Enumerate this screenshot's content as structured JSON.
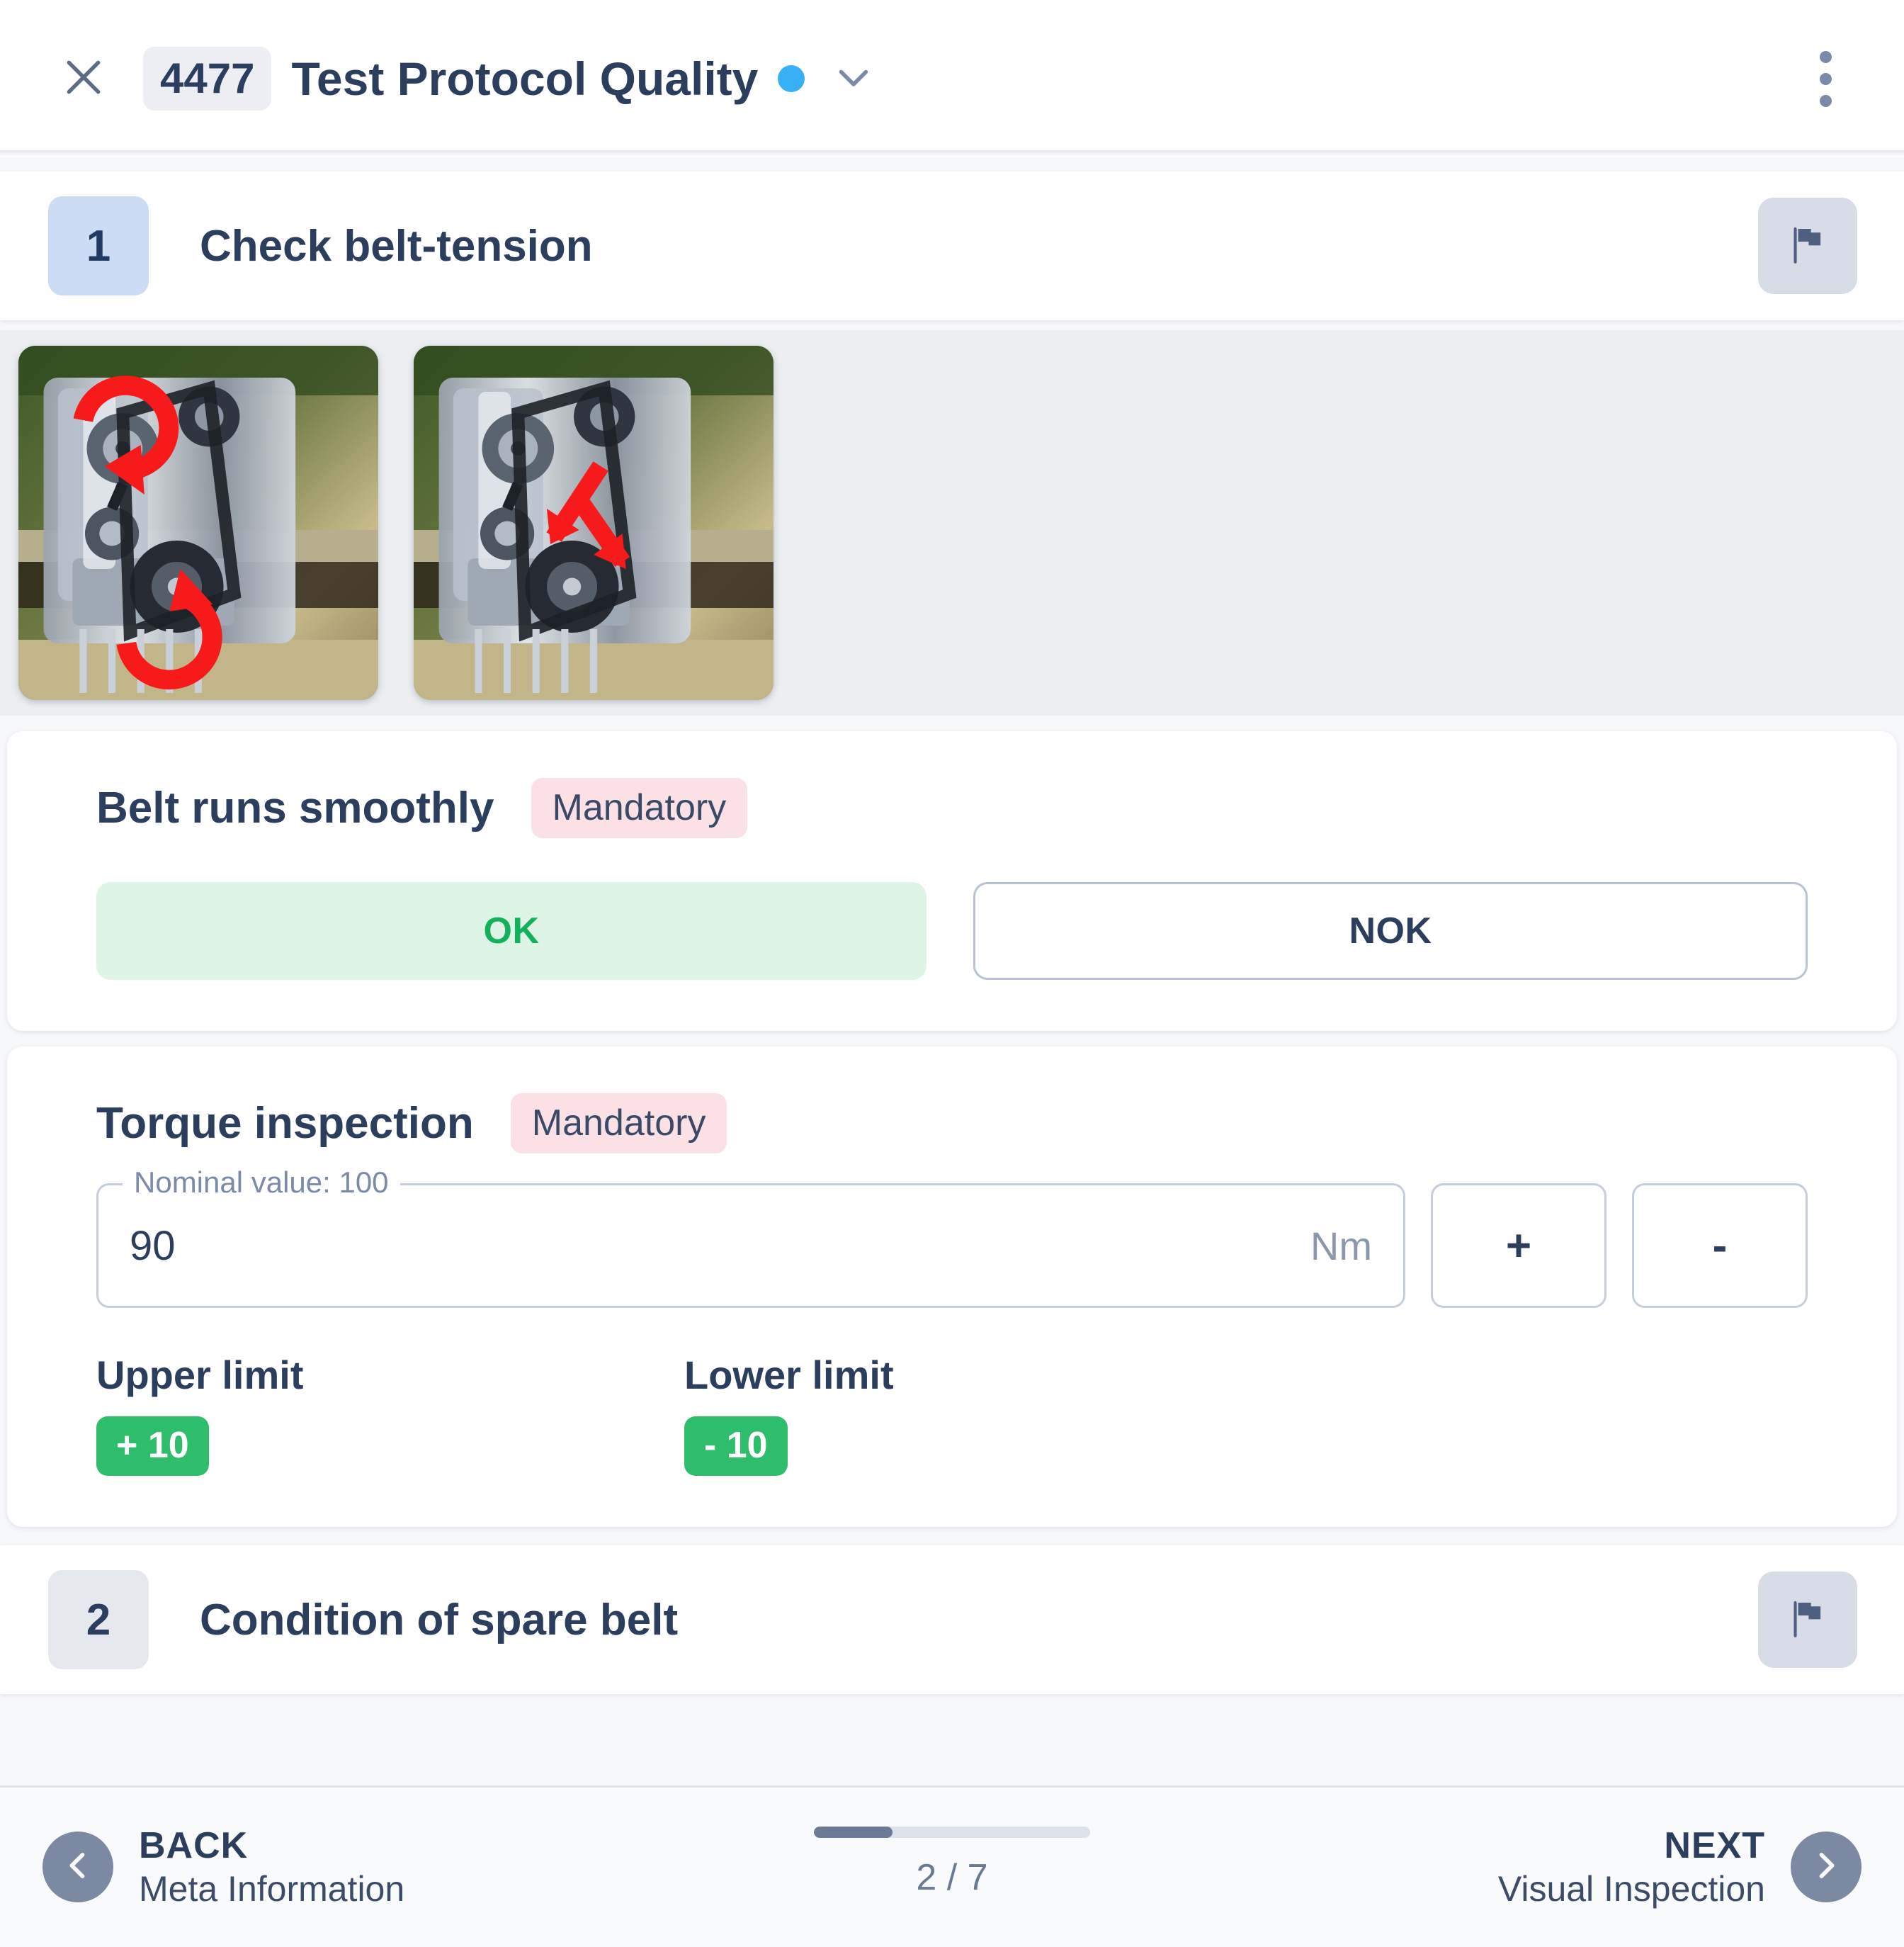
{
  "header": {
    "close_icon": "close-icon",
    "doc_id": "4477",
    "title": "Test Protocol Quality",
    "status_dot_color": "#38b0f5",
    "chevron_icon": "chevron-down-icon",
    "menu_icon": "kebab-menu-icon"
  },
  "step": {
    "number": "1",
    "title": "Check belt-tension",
    "flag_icon": "flag-icon",
    "attachments": [
      {
        "name": "engine-belt-rotation-photo",
        "alt": "Engine with red rotation arrows"
      },
      {
        "name": "engine-belt-direction-photo",
        "alt": "Engine with red direction arrows"
      }
    ]
  },
  "checks": [
    {
      "label": "Belt runs smoothly",
      "badge": "Mandatory",
      "type": "ok_nok",
      "ok_label": "OK",
      "nok_label": "NOK",
      "selected": "OK"
    },
    {
      "label": "Torque inspection",
      "badge": "Mandatory",
      "type": "numeric",
      "legend": "Nominal value: 100",
      "value": "90",
      "unit": "Nm",
      "plus_label": "+",
      "minus_label": "-",
      "upper_limit_title": "Upper limit",
      "upper_limit_value": "+ 10",
      "lower_limit_title": "Lower limit",
      "lower_limit_value": "- 10"
    }
  ],
  "next_step": {
    "number": "2",
    "title": "Condition of spare belt"
  },
  "bottom_nav": {
    "back_label": "BACK",
    "back_sub": "Meta Information",
    "next_label": "NEXT",
    "next_sub": "Visual Inspection",
    "progress_text": "2 / 7",
    "progress_current": 2,
    "progress_total": 7
  },
  "colors": {
    "accent_blue": "#38b0f5",
    "ok_green": "#14b15c",
    "limit_green": "#2ebd6b",
    "mandatory_pink": "#fbe0e6",
    "text_dark": "#2c3e5d"
  }
}
